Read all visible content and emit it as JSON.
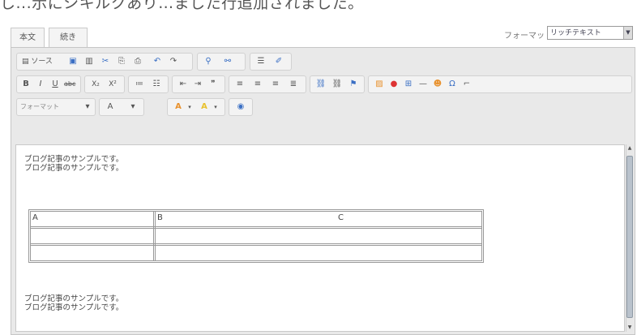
{
  "caption": "し...示にシキルクあり…ました行追加されました。",
  "tabs": [
    "本文",
    "続き"
  ],
  "format": {
    "label": "フォーマット",
    "value": "リッチテキスト"
  },
  "toolbar": {
    "source_label": "ソース",
    "format_label": "フォーマット"
  },
  "content": {
    "paragraphs_top": [
      "ブログ記事のサンプルです。",
      "ブログ記事のサンプルです。"
    ],
    "table_headers": [
      "A",
      "B",
      "C"
    ],
    "paragraphs_bottom": [
      "ブログ記事のサンプルです。",
      "ブログ記事のサンプルです。"
    ]
  },
  "colors": {
    "accent_red": "#d33",
    "accent_orange": "#e8912d",
    "accent_blue": "#3a6fc4",
    "accent_green": "#3c9b4a"
  }
}
